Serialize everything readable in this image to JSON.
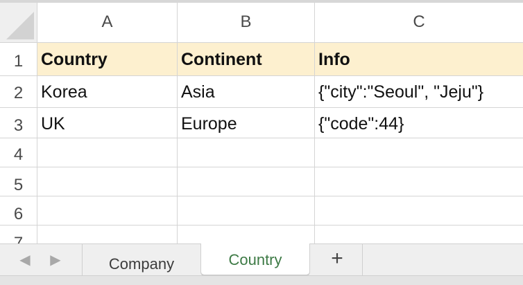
{
  "columns": [
    "A",
    "B",
    "C"
  ],
  "rows": [
    "1",
    "2",
    "3",
    "4",
    "5",
    "6",
    "7"
  ],
  "cells": {
    "A1": "Country",
    "B1": "Continent",
    "C1": "Info",
    "A2": "Korea",
    "B2": "Asia",
    "C2": "{\"city\":\"Seoul\", \"Jeju\"}",
    "A3": "UK",
    "B3": "Europe",
    "C3": "{\"code\":44}"
  },
  "tabs": [
    {
      "label": "Company",
      "active": false
    },
    {
      "label": "Country",
      "active": true
    }
  ],
  "nav": {
    "prev_icon": "chevron-left-icon",
    "next_icon": "chevron-right-icon",
    "add_icon": "plus-icon",
    "prev_glyph": "◀",
    "next_glyph": "▶",
    "add_glyph": "+"
  },
  "colors": {
    "header_fill": "#fdf0cf",
    "active_tab_text": "#3d7a45"
  }
}
